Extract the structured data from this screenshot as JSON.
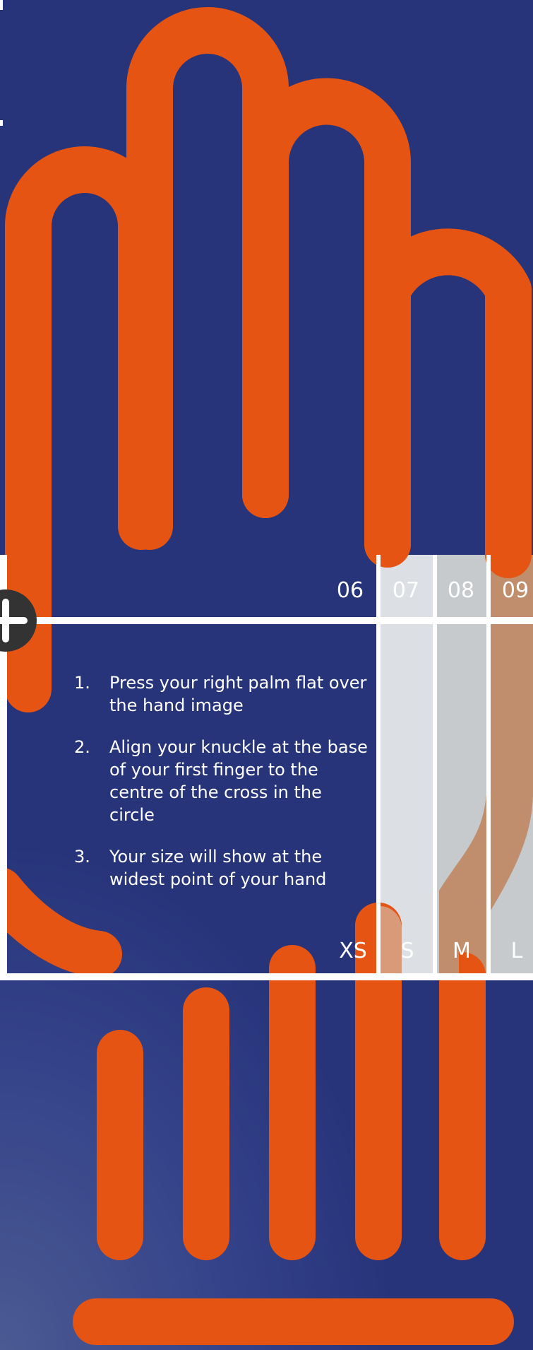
{
  "size_chart": {
    "glove_sizes": [
      "06",
      "07",
      "08",
      "09"
    ],
    "size_labels": [
      "XS",
      "S",
      "M",
      "L"
    ]
  },
  "instructions": [
    {
      "number": "1.",
      "text": "Press your right palm flat over the hand image"
    },
    {
      "number": "2.",
      "text": "Align your knuckle at the base of your first finger to the centre of the cross in the circle"
    },
    {
      "number": "3.",
      "text": "Your size will show at the widest point of your hand"
    }
  ],
  "colors": {
    "background": "#27347a",
    "hand": "#e55412",
    "frame": "#ffffff",
    "band_light": "#dcdfe3",
    "band_mid": "#c6cacd",
    "band_skin": "#c08e6c",
    "crosshair": "#333333"
  },
  "icons": {
    "crosshair": "plus-circle-icon"
  }
}
